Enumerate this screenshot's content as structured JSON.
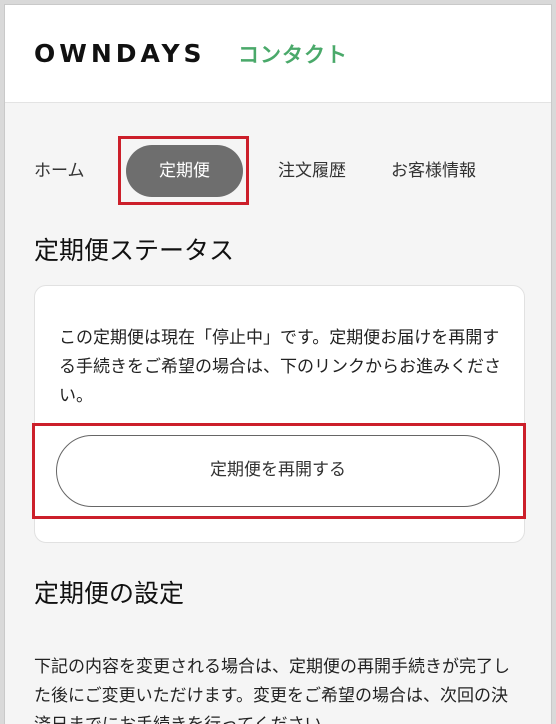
{
  "header": {
    "brand": "OWNDAYS",
    "section": "コンタクト"
  },
  "nav": {
    "items": [
      "ホーム",
      "定期便",
      "注文履歴",
      "お客様情報"
    ],
    "active_index": 1
  },
  "status": {
    "title": "定期便ステータス",
    "message": "この定期便は現在「停止中」です。定期便お届けを再開する手続きをご希望の場合は、下のリンクからお進みください。",
    "button_label": "定期便を再開する"
  },
  "settings": {
    "title": "定期便の設定",
    "text": "下記の内容を変更される場合は、定期便の再開手続きが完了した後にご変更いただけます。変更をご希望の場合は、次回の決済日までにお手続きを行ってください。"
  },
  "colors": {
    "highlight": "#cc1f2a",
    "brand_green": "#4aa96a",
    "pill": "#6e6e6e"
  }
}
